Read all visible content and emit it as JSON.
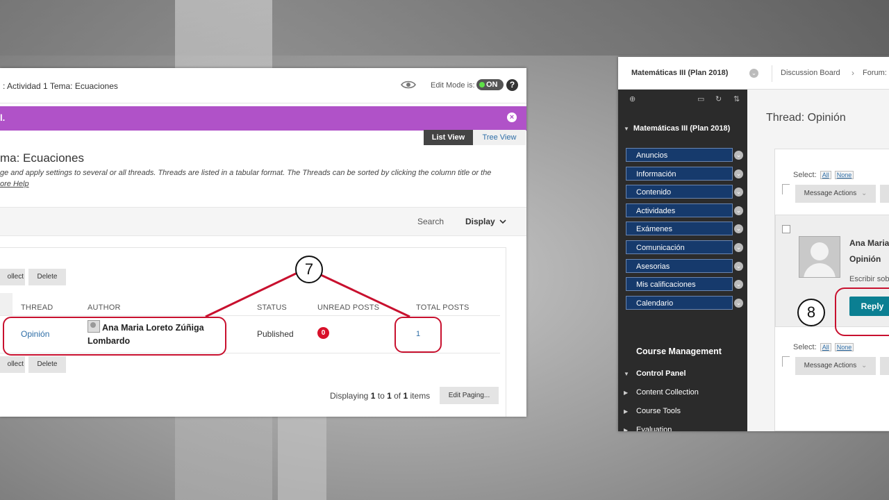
{
  "left": {
    "breadcrumb": ": Actividad 1 Tema: Ecuaciones",
    "edit_mode_label": "Edit Mode is:",
    "edit_mode_value": "ON",
    "help_icon": "?",
    "banner_text": "l.",
    "view_tabs": {
      "list": "List View",
      "tree": "Tree View"
    },
    "forum_title": "ma: Ecuaciones",
    "description_line1": "ge and apply settings to several or all threads. Threads are listed in a tabular format. The Threads can be sorted by clicking the column title or the",
    "description_more": "ore Help",
    "search_label": "Search",
    "display_label": "Display",
    "buttons": {
      "collect": "ollect",
      "delete": "Delete",
      "edit_paging": "Edit Paging..."
    },
    "columns": {
      "thread": "THREAD",
      "author": "AUTHOR",
      "status": "STATUS",
      "unread": "UNREAD POSTS",
      "total": "TOTAL POSTS"
    },
    "rows": [
      {
        "thread": "Opinión",
        "author_line1": "Ana Maria Loreto Zúñiga",
        "author_line2": "Lombardo",
        "status": "Published",
        "unread": "0",
        "total": "1"
      }
    ],
    "paging": {
      "prefix": "Displaying",
      "from": "1",
      "to_word": "to",
      "to": "1",
      "of_word": "of",
      "total": "1",
      "suffix": "items"
    }
  },
  "annotations": {
    "step7": "7",
    "step8": "8"
  },
  "right": {
    "course_title": "Matemáticas III (Plan 2018)",
    "crumb1": "Discussion Board",
    "crumb_arrow": "›",
    "crumb2": "Forum:",
    "sidebar_course": "Matemáticas III (Plan 2018)",
    "nav_items": [
      "Anuncios",
      "Información",
      "Contenido",
      "Actividades",
      "Exámenes",
      "Comunicación",
      "Asesorias",
      "Mis calificaciones",
      "Calendario"
    ],
    "course_management": "Course Management",
    "control_panel": "Control Panel",
    "cp_items": [
      "Content Collection",
      "Course Tools",
      "Evaluation"
    ],
    "thread_title": "Thread: Opinión",
    "select_label": "Select:",
    "select_all": "All",
    "select_none": "None",
    "message_actions": "Message Actions",
    "post_author": "Ana Maria",
    "post_subject": "Opinión",
    "post_body": "Escribir sob",
    "reply_label": "Reply"
  },
  "colors": {
    "banner": "#b052c8",
    "nav_item": "#163a6c",
    "reply": "#0b7f92",
    "highlight": "#c8102e",
    "unread_badge": "#d8102a"
  }
}
